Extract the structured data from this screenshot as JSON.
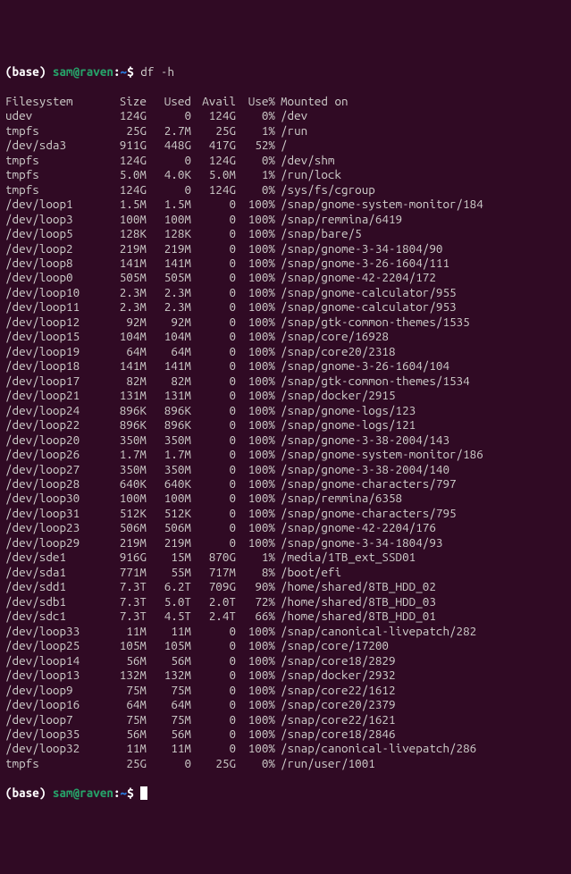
{
  "prompt": {
    "env": "(base) ",
    "user_host": "sam@raven",
    "sep": ":",
    "cwd": "~",
    "dollar": "$ ",
    "command": "df -h"
  },
  "header": {
    "filesystem": "Filesystem",
    "size": "Size",
    "used": "Used",
    "avail": "Avail",
    "usep": "Use%",
    "mounted": "Mounted on"
  },
  "rows": [
    {
      "fs": "udev",
      "size": "124G",
      "used": "0",
      "avail": "124G",
      "usep": "0%",
      "mnt": "/dev"
    },
    {
      "fs": "tmpfs",
      "size": "25G",
      "used": "2.7M",
      "avail": "25G",
      "usep": "1%",
      "mnt": "/run"
    },
    {
      "fs": "/dev/sda3",
      "size": "911G",
      "used": "448G",
      "avail": "417G",
      "usep": "52%",
      "mnt": "/"
    },
    {
      "fs": "tmpfs",
      "size": "124G",
      "used": "0",
      "avail": "124G",
      "usep": "0%",
      "mnt": "/dev/shm"
    },
    {
      "fs": "tmpfs",
      "size": "5.0M",
      "used": "4.0K",
      "avail": "5.0M",
      "usep": "1%",
      "mnt": "/run/lock"
    },
    {
      "fs": "tmpfs",
      "size": "124G",
      "used": "0",
      "avail": "124G",
      "usep": "0%",
      "mnt": "/sys/fs/cgroup"
    },
    {
      "fs": "/dev/loop1",
      "size": "1.5M",
      "used": "1.5M",
      "avail": "0",
      "usep": "100%",
      "mnt": "/snap/gnome-system-monitor/184"
    },
    {
      "fs": "/dev/loop3",
      "size": "100M",
      "used": "100M",
      "avail": "0",
      "usep": "100%",
      "mnt": "/snap/remmina/6419"
    },
    {
      "fs": "/dev/loop5",
      "size": "128K",
      "used": "128K",
      "avail": "0",
      "usep": "100%",
      "mnt": "/snap/bare/5"
    },
    {
      "fs": "/dev/loop2",
      "size": "219M",
      "used": "219M",
      "avail": "0",
      "usep": "100%",
      "mnt": "/snap/gnome-3-34-1804/90"
    },
    {
      "fs": "/dev/loop8",
      "size": "141M",
      "used": "141M",
      "avail": "0",
      "usep": "100%",
      "mnt": "/snap/gnome-3-26-1604/111"
    },
    {
      "fs": "/dev/loop0",
      "size": "505M",
      "used": "505M",
      "avail": "0",
      "usep": "100%",
      "mnt": "/snap/gnome-42-2204/172"
    },
    {
      "fs": "/dev/loop10",
      "size": "2.3M",
      "used": "2.3M",
      "avail": "0",
      "usep": "100%",
      "mnt": "/snap/gnome-calculator/955"
    },
    {
      "fs": "/dev/loop11",
      "size": "2.3M",
      "used": "2.3M",
      "avail": "0",
      "usep": "100%",
      "mnt": "/snap/gnome-calculator/953"
    },
    {
      "fs": "/dev/loop12",
      "size": "92M",
      "used": "92M",
      "avail": "0",
      "usep": "100%",
      "mnt": "/snap/gtk-common-themes/1535"
    },
    {
      "fs": "/dev/loop15",
      "size": "104M",
      "used": "104M",
      "avail": "0",
      "usep": "100%",
      "mnt": "/snap/core/16928"
    },
    {
      "fs": "/dev/loop19",
      "size": "64M",
      "used": "64M",
      "avail": "0",
      "usep": "100%",
      "mnt": "/snap/core20/2318"
    },
    {
      "fs": "/dev/loop18",
      "size": "141M",
      "used": "141M",
      "avail": "0",
      "usep": "100%",
      "mnt": "/snap/gnome-3-26-1604/104"
    },
    {
      "fs": "/dev/loop17",
      "size": "82M",
      "used": "82M",
      "avail": "0",
      "usep": "100%",
      "mnt": "/snap/gtk-common-themes/1534"
    },
    {
      "fs": "/dev/loop21",
      "size": "131M",
      "used": "131M",
      "avail": "0",
      "usep": "100%",
      "mnt": "/snap/docker/2915"
    },
    {
      "fs": "/dev/loop24",
      "size": "896K",
      "used": "896K",
      "avail": "0",
      "usep": "100%",
      "mnt": "/snap/gnome-logs/123"
    },
    {
      "fs": "/dev/loop22",
      "size": "896K",
      "used": "896K",
      "avail": "0",
      "usep": "100%",
      "mnt": "/snap/gnome-logs/121"
    },
    {
      "fs": "/dev/loop20",
      "size": "350M",
      "used": "350M",
      "avail": "0",
      "usep": "100%",
      "mnt": "/snap/gnome-3-38-2004/143"
    },
    {
      "fs": "/dev/loop26",
      "size": "1.7M",
      "used": "1.7M",
      "avail": "0",
      "usep": "100%",
      "mnt": "/snap/gnome-system-monitor/186"
    },
    {
      "fs": "/dev/loop27",
      "size": "350M",
      "used": "350M",
      "avail": "0",
      "usep": "100%",
      "mnt": "/snap/gnome-3-38-2004/140"
    },
    {
      "fs": "/dev/loop28",
      "size": "640K",
      "used": "640K",
      "avail": "0",
      "usep": "100%",
      "mnt": "/snap/gnome-characters/797"
    },
    {
      "fs": "/dev/loop30",
      "size": "100M",
      "used": "100M",
      "avail": "0",
      "usep": "100%",
      "mnt": "/snap/remmina/6358"
    },
    {
      "fs": "/dev/loop31",
      "size": "512K",
      "used": "512K",
      "avail": "0",
      "usep": "100%",
      "mnt": "/snap/gnome-characters/795"
    },
    {
      "fs": "/dev/loop23",
      "size": "506M",
      "used": "506M",
      "avail": "0",
      "usep": "100%",
      "mnt": "/snap/gnome-42-2204/176"
    },
    {
      "fs": "/dev/loop29",
      "size": "219M",
      "used": "219M",
      "avail": "0",
      "usep": "100%",
      "mnt": "/snap/gnome-3-34-1804/93"
    },
    {
      "fs": "/dev/sde1",
      "size": "916G",
      "used": "15M",
      "avail": "870G",
      "usep": "1%",
      "mnt": "/media/1TB_ext_SSD01"
    },
    {
      "fs": "/dev/sda1",
      "size": "771M",
      "used": "55M",
      "avail": "717M",
      "usep": "8%",
      "mnt": "/boot/efi"
    },
    {
      "fs": "/dev/sdd1",
      "size": "7.3T",
      "used": "6.2T",
      "avail": "709G",
      "usep": "90%",
      "mnt": "/home/shared/8TB_HDD_02"
    },
    {
      "fs": "/dev/sdb1",
      "size": "7.3T",
      "used": "5.0T",
      "avail": "2.0T",
      "usep": "72%",
      "mnt": "/home/shared/8TB_HDD_03"
    },
    {
      "fs": "/dev/sdc1",
      "size": "7.3T",
      "used": "4.5T",
      "avail": "2.4T",
      "usep": "66%",
      "mnt": "/home/shared/8TB_HDD_01"
    },
    {
      "fs": "/dev/loop33",
      "size": "11M",
      "used": "11M",
      "avail": "0",
      "usep": "100%",
      "mnt": "/snap/canonical-livepatch/282"
    },
    {
      "fs": "/dev/loop25",
      "size": "105M",
      "used": "105M",
      "avail": "0",
      "usep": "100%",
      "mnt": "/snap/core/17200"
    },
    {
      "fs": "/dev/loop14",
      "size": "56M",
      "used": "56M",
      "avail": "0",
      "usep": "100%",
      "mnt": "/snap/core18/2829"
    },
    {
      "fs": "/dev/loop13",
      "size": "132M",
      "used": "132M",
      "avail": "0",
      "usep": "100%",
      "mnt": "/snap/docker/2932"
    },
    {
      "fs": "/dev/loop9",
      "size": "75M",
      "used": "75M",
      "avail": "0",
      "usep": "100%",
      "mnt": "/snap/core22/1612"
    },
    {
      "fs": "/dev/loop16",
      "size": "64M",
      "used": "64M",
      "avail": "0",
      "usep": "100%",
      "mnt": "/snap/core20/2379"
    },
    {
      "fs": "/dev/loop7",
      "size": "75M",
      "used": "75M",
      "avail": "0",
      "usep": "100%",
      "mnt": "/snap/core22/1621"
    },
    {
      "fs": "/dev/loop35",
      "size": "56M",
      "used": "56M",
      "avail": "0",
      "usep": "100%",
      "mnt": "/snap/core18/2846"
    },
    {
      "fs": "/dev/loop32",
      "size": "11M",
      "used": "11M",
      "avail": "0",
      "usep": "100%",
      "mnt": "/snap/canonical-livepatch/286"
    },
    {
      "fs": "tmpfs",
      "size": "25G",
      "used": "0",
      "avail": "25G",
      "usep": "0%",
      "mnt": "/run/user/1001"
    }
  ]
}
